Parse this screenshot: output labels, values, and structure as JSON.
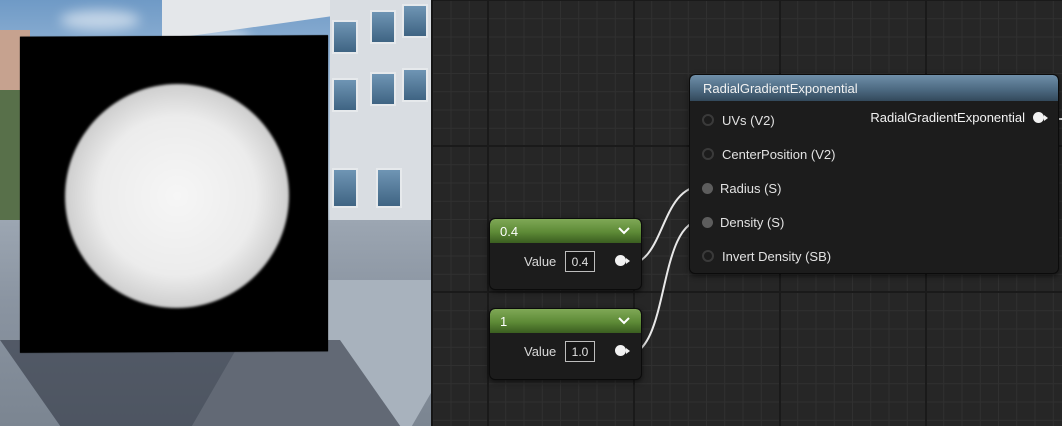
{
  "viewport": {
    "preview": "radial-gradient-sphere"
  },
  "graph": {
    "nodes": {
      "radial_gradient": {
        "title": "RadialGradientExponential",
        "output_label": "RadialGradientExponential",
        "inputs": [
          {
            "label": "UVs (V2)",
            "connected": false
          },
          {
            "label": "CenterPosition (V2)",
            "connected": false
          },
          {
            "label": "Radius (S)",
            "connected": true
          },
          {
            "label": "Density (S)",
            "connected": true
          },
          {
            "label": "Invert Density (SB)",
            "connected": false
          }
        ]
      },
      "constant_radius": {
        "title": "0.4",
        "value_label": "Value",
        "value": "0.4"
      },
      "constant_density": {
        "title": "1",
        "value_label": "Value",
        "value": "1.0"
      }
    }
  },
  "colors": {
    "constant_header": "#5d8a36",
    "function_header": "#4d6a82",
    "wire": "#e8e8e8",
    "graph_background": "#262626"
  },
  "icons": [
    "chevron-down-icon",
    "pin-filled-icon",
    "pin-empty-icon"
  ]
}
